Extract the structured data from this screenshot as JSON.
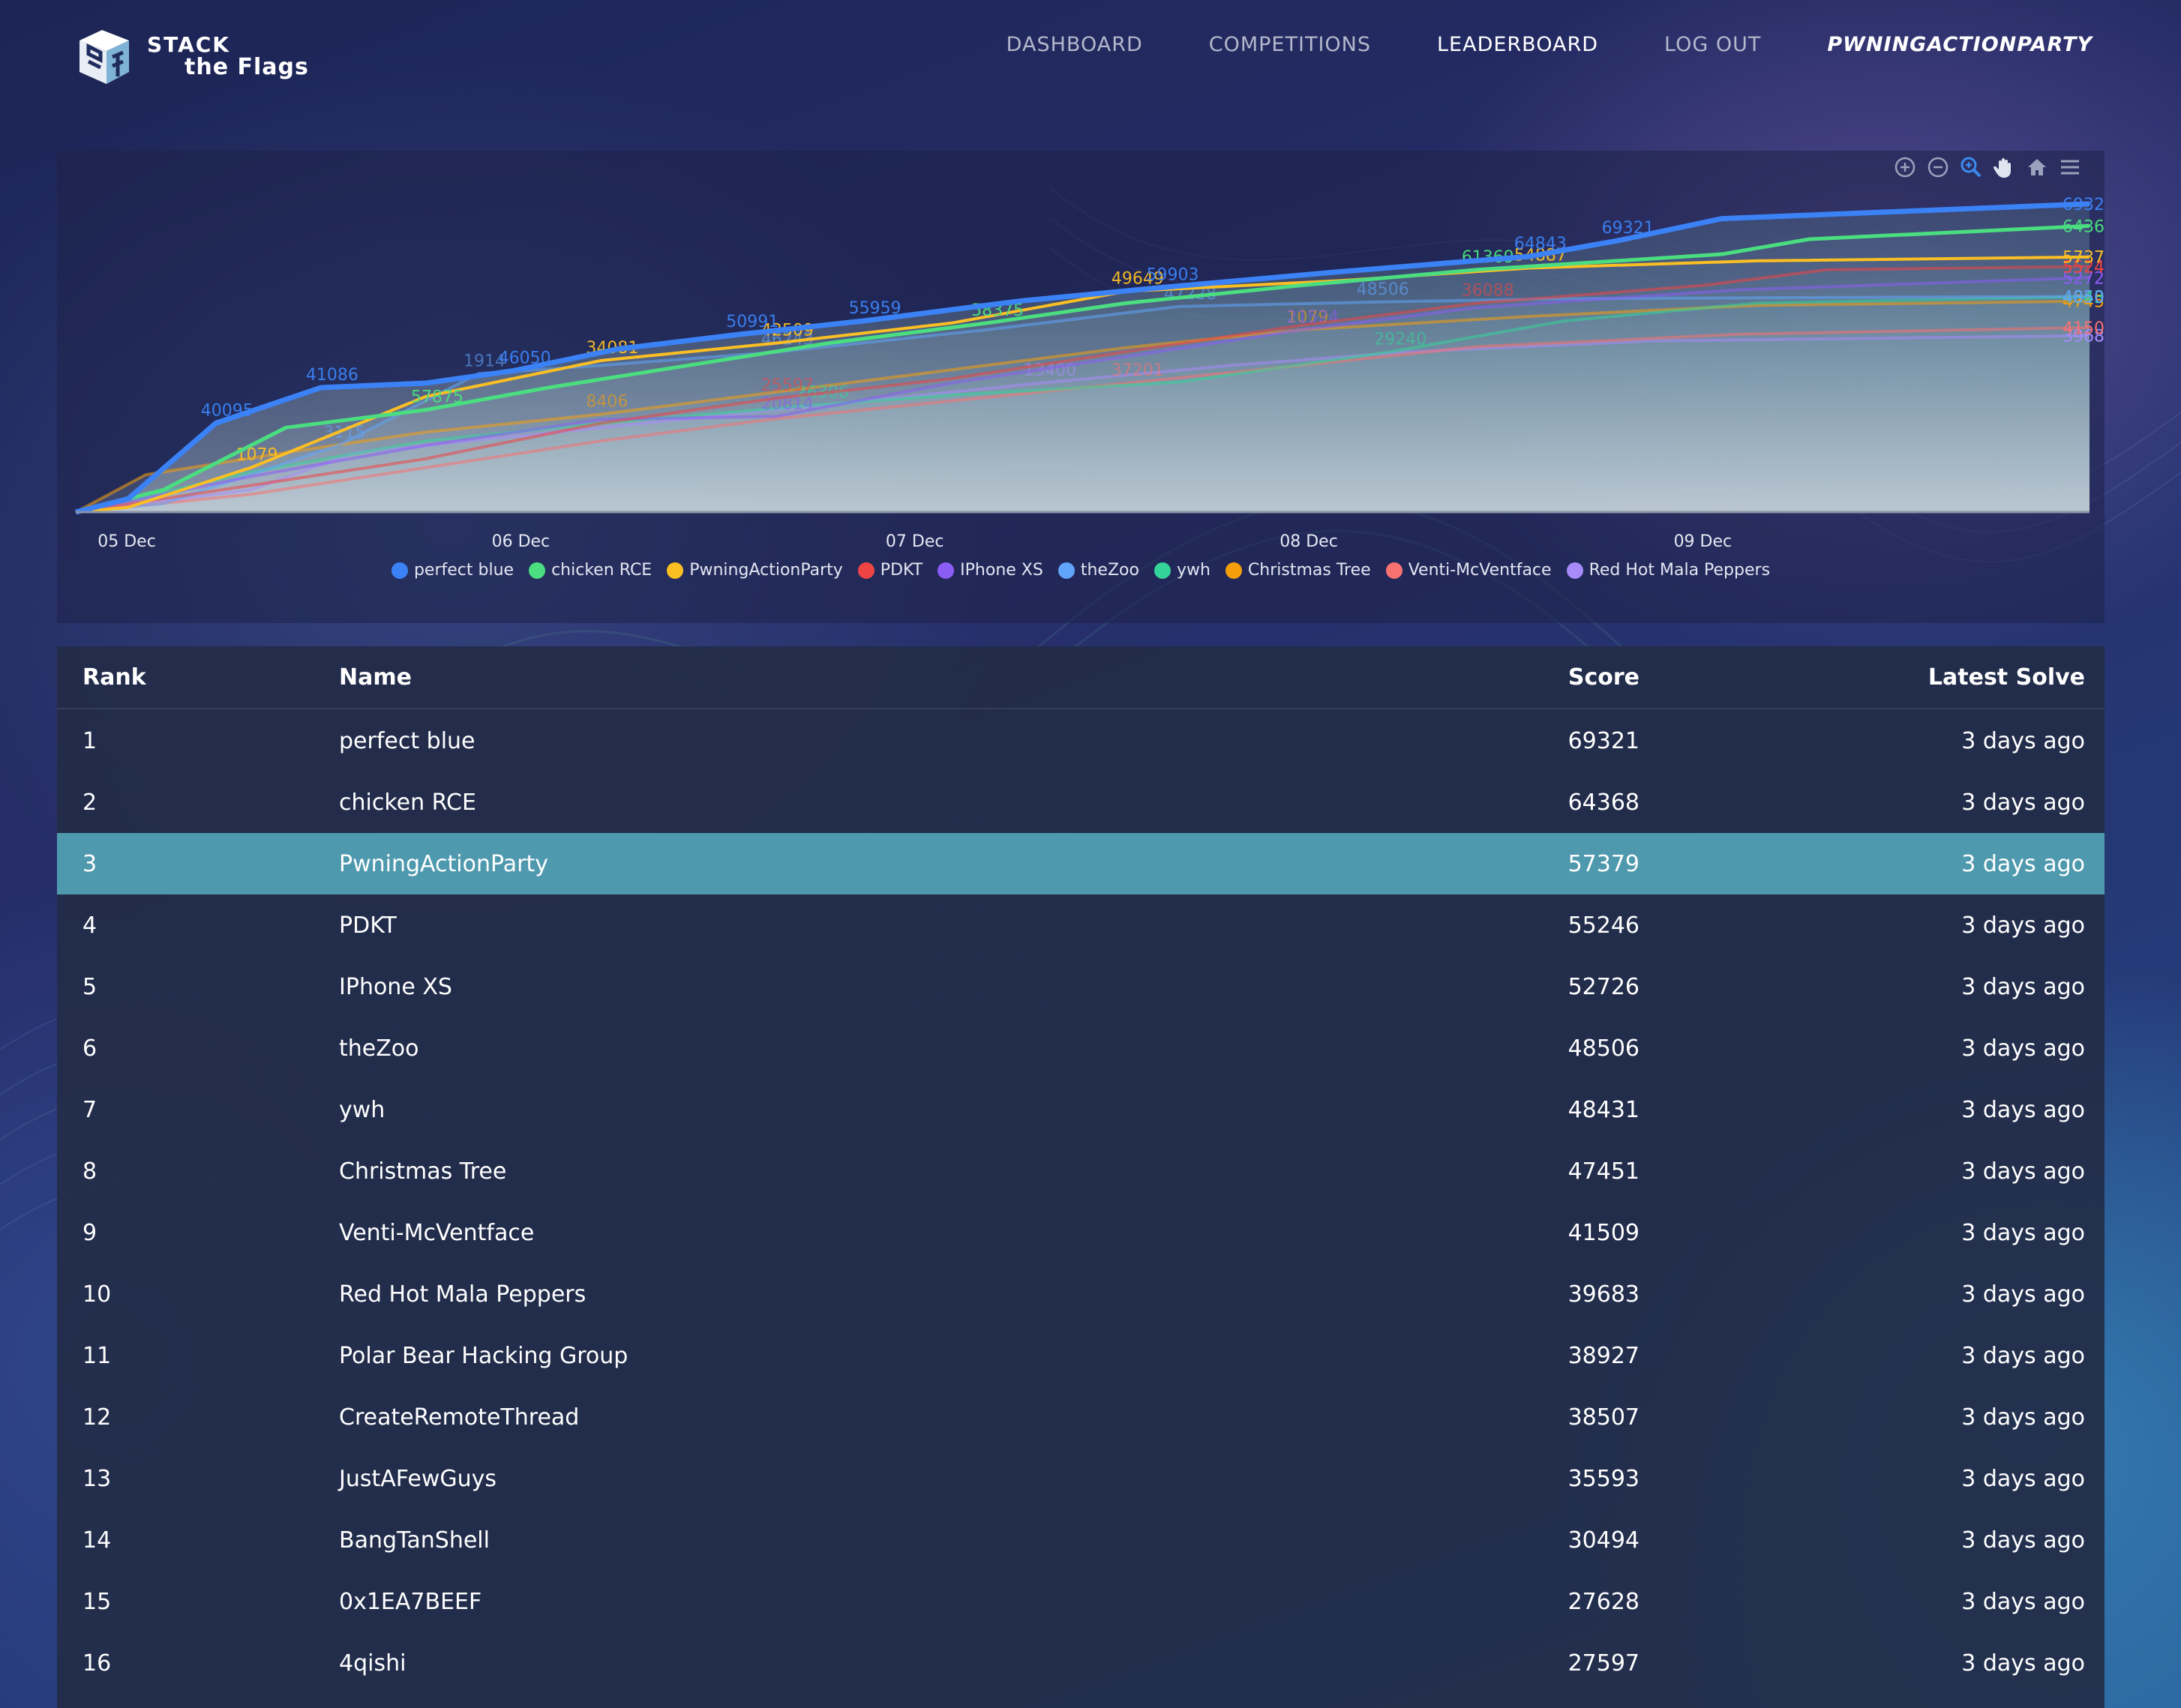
{
  "brand": {
    "line1": "STACK",
    "line2": "the Flags"
  },
  "nav": [
    {
      "label": "DASHBOARD",
      "active": false
    },
    {
      "label": "COMPETITIONS",
      "active": false
    },
    {
      "label": "LEADERBOARD",
      "active": true
    },
    {
      "label": "LOG OUT",
      "active": false
    },
    {
      "label": "PWNINGACTIONPARTY",
      "user": true
    }
  ],
  "toolbar": [
    "zoom-in-icon",
    "zoom-out-icon",
    "selection-zoom-icon",
    "pan-icon",
    "reset-home-icon",
    "menu-icon"
  ],
  "chart_data": {
    "type": "area",
    "x_axis": {
      "type": "datetime",
      "ticks": [
        "05 Dec",
        "06 Dec",
        "07 Dec",
        "08 Dec",
        "09 Dec"
      ]
    },
    "legend_position": "bottom",
    "series": [
      {
        "name": "perfect blue",
        "color": "#3b82f6",
        "final": 69321,
        "labels": [
          "40095",
          "41086",
          "46050",
          "50991",
          "55959",
          "59903",
          "64843",
          "69321"
        ],
        "points": [
          [
            0,
            0
          ],
          [
            0.3,
            30
          ],
          [
            0.8,
            200
          ],
          [
            1.4,
            280
          ],
          [
            2.0,
            290
          ],
          [
            2.5,
            318
          ],
          [
            3.1,
            367
          ],
          [
            3.8,
            400
          ],
          [
            4.5,
            430
          ],
          [
            5.4,
            475
          ],
          [
            6.2,
            505
          ],
          [
            7.2,
            540
          ],
          [
            8.3,
            575
          ],
          [
            8.8,
            610
          ],
          [
            9.4,
            660
          ],
          [
            11.5,
            693.21
          ]
        ]
      },
      {
        "name": "chicken RCE",
        "color": "#4ade80",
        "final": 64368,
        "labels": [
          "57875",
          "58375",
          "61369"
        ],
        "points": [
          [
            0,
            0
          ],
          [
            0.5,
            50
          ],
          [
            1.2,
            190
          ],
          [
            2.0,
            230
          ],
          [
            2.7,
            280
          ],
          [
            3.5,
            330
          ],
          [
            4.3,
            380
          ],
          [
            5.2,
            425
          ],
          [
            6.0,
            470
          ],
          [
            7.0,
            510
          ],
          [
            8.0,
            545
          ],
          [
            9.4,
            580
          ],
          [
            9.9,
            613.69
          ],
          [
            11.5,
            643.68
          ]
        ]
      },
      {
        "name": "PwningActionParty",
        "color": "#fbbf24",
        "final": 57379,
        "labels": [
          "1079",
          "34081",
          "42509",
          "49649",
          "54887"
        ],
        "points": [
          [
            0,
            0
          ],
          [
            0.3,
            10.79
          ],
          [
            1.0,
            100
          ],
          [
            2.0,
            260
          ],
          [
            3.0,
            340.81
          ],
          [
            4.0,
            380
          ],
          [
            5.0,
            425.09
          ],
          [
            6.0,
            496.49
          ],
          [
            7.2,
            520
          ],
          [
            8.3,
            548.87
          ],
          [
            9.6,
            565
          ],
          [
            11.5,
            573.79
          ]
        ]
      },
      {
        "name": "PDKT",
        "color": "#ef4444",
        "final": 55246,
        "labels": [
          "25597",
          "36088"
        ],
        "points": [
          [
            0,
            0
          ],
          [
            1.0,
            60
          ],
          [
            2.0,
            120
          ],
          [
            3.0,
            200
          ],
          [
            4.0,
            255.97
          ],
          [
            5.0,
            300
          ],
          [
            6.0,
            360.88
          ],
          [
            7.0,
            420
          ],
          [
            8.0,
            470
          ],
          [
            9.3,
            510
          ],
          [
            10.0,
            545
          ],
          [
            11.5,
            552.46
          ]
        ]
      },
      {
        "name": "IPhone XS",
        "color": "#8b5cf6",
        "final": 52726,
        "labels": [
          "20814",
          "21524"
        ],
        "points": [
          [
            0,
            0
          ],
          [
            1.0,
            80
          ],
          [
            2.0,
            150
          ],
          [
            3.0,
            208.14
          ],
          [
            4.0,
            215.24
          ],
          [
            5.0,
            290
          ],
          [
            6.0,
            350
          ],
          [
            7.0,
            410
          ],
          [
            8.0,
            460
          ],
          [
            9.5,
            500
          ],
          [
            11.5,
            527.26
          ]
        ]
      },
      {
        "name": "theZoo",
        "color": "#60a5fa",
        "final": 48506,
        "labels": [
          "3115",
          "1914",
          "46243",
          "47228",
          "48506"
        ],
        "points": [
          [
            0,
            0
          ],
          [
            0.5,
            19.14
          ],
          [
            1.5,
            150
          ],
          [
            2.3,
            311.5
          ],
          [
            3.0,
            330
          ],
          [
            4.0,
            360
          ],
          [
            5.2,
            410
          ],
          [
            6.3,
            462.43
          ],
          [
            7.4,
            472.28
          ],
          [
            8.5,
            480
          ],
          [
            11.5,
            485.06
          ]
        ]
      },
      {
        "name": "ywh",
        "color": "#34d399",
        "final": 48431,
        "labels": [
          "26306",
          "29240"
        ],
        "points": [
          [
            0,
            0
          ],
          [
            1.0,
            90
          ],
          [
            2.0,
            160
          ],
          [
            3.0,
            200
          ],
          [
            4.2,
            240
          ],
          [
            5.0,
            263.06
          ],
          [
            6.3,
            292.4
          ],
          [
            7.5,
            360
          ],
          [
            8.5,
            430
          ],
          [
            9.6,
            470
          ],
          [
            11.5,
            484.31
          ]
        ]
      },
      {
        "name": "Christmas Tree",
        "color": "#f59e0b",
        "final": 47451,
        "labels": [
          "8406",
          "1079"
        ],
        "points": [
          [
            0,
            0
          ],
          [
            0.4,
            84.06
          ],
          [
            1.3,
            140
          ],
          [
            2.0,
            180
          ],
          [
            3.0,
            220
          ],
          [
            4.0,
            270
          ],
          [
            5.0,
            320
          ],
          [
            6.0,
            370
          ],
          [
            7.0,
            410
          ],
          [
            8.3,
            440
          ],
          [
            9.6,
            465
          ],
          [
            11.5,
            474.51
          ]
        ]
      },
      {
        "name": "Venti-McVentface",
        "color": "#f87171",
        "final": 41509,
        "labels": [
          "37201"
        ],
        "points": [
          [
            0,
            0
          ],
          [
            1.0,
            40
          ],
          [
            2.0,
            100
          ],
          [
            3.0,
            160
          ],
          [
            4.0,
            210
          ],
          [
            5.0,
            250
          ],
          [
            6.0,
            290
          ],
          [
            7.0,
            330
          ],
          [
            8.0,
            372.01
          ],
          [
            9.5,
            400
          ],
          [
            11.5,
            415.09
          ]
        ]
      },
      {
        "name": "Red Hot Mala Peppers",
        "color": "#a78bfa",
        "final": 39683,
        "labels": [
          "13400"
        ],
        "points": [
          [
            0,
            0
          ],
          [
            1.0,
            50
          ],
          [
            1.6,
            134.0
          ],
          [
            2.5,
            170
          ],
          [
            3.5,
            210
          ],
          [
            4.5,
            250
          ],
          [
            5.5,
            290
          ],
          [
            6.6,
            330
          ],
          [
            7.6,
            360
          ],
          [
            9.0,
            385
          ],
          [
            11.5,
            396.83
          ]
        ]
      }
    ]
  },
  "table": {
    "headers": {
      "rank": "Rank",
      "name": "Name",
      "score": "Score",
      "latest": "Latest Solve"
    },
    "rows": [
      {
        "rank": "1",
        "name": "perfect blue",
        "score": "69321",
        "latest": "3 days ago"
      },
      {
        "rank": "2",
        "name": "chicken RCE",
        "score": "64368",
        "latest": "3 days ago"
      },
      {
        "rank": "3",
        "name": "PwningActionParty",
        "score": "57379",
        "latest": "3 days ago",
        "highlight": true
      },
      {
        "rank": "4",
        "name": "PDKT",
        "score": "55246",
        "latest": "3 days ago"
      },
      {
        "rank": "5",
        "name": "IPhone XS",
        "score": "52726",
        "latest": "3 days ago"
      },
      {
        "rank": "6",
        "name": "theZoo",
        "score": "48506",
        "latest": "3 days ago"
      },
      {
        "rank": "7",
        "name": "ywh",
        "score": "48431",
        "latest": "3 days ago"
      },
      {
        "rank": "8",
        "name": "Christmas Tree",
        "score": "47451",
        "latest": "3 days ago"
      },
      {
        "rank": "9",
        "name": "Venti-McVentface",
        "score": "41509",
        "latest": "3 days ago"
      },
      {
        "rank": "10",
        "name": "Red Hot Mala Peppers",
        "score": "39683",
        "latest": "3 days ago"
      },
      {
        "rank": "11",
        "name": "Polar Bear Hacking Group",
        "score": "38927",
        "latest": "3 days ago"
      },
      {
        "rank": "12",
        "name": "CreateRemoteThread",
        "score": "38507",
        "latest": "3 days ago"
      },
      {
        "rank": "13",
        "name": "JustAFewGuys",
        "score": "35593",
        "latest": "3 days ago"
      },
      {
        "rank": "14",
        "name": "BangTanShell",
        "score": "30494",
        "latest": "3 days ago"
      },
      {
        "rank": "15",
        "name": "0x1EA7BEEF",
        "score": "27628",
        "latest": "3 days ago"
      },
      {
        "rank": "16",
        "name": "4qishi",
        "score": "27597",
        "latest": "3 days ago"
      }
    ]
  }
}
